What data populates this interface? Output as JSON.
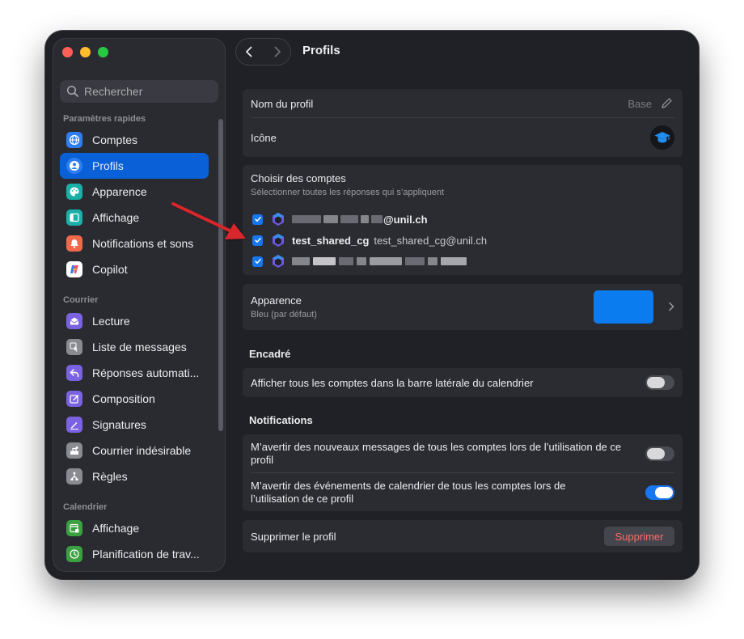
{
  "window": {
    "title": "Profils",
    "accent": "#0a60d6"
  },
  "search": {
    "placeholder": "Rechercher"
  },
  "sidebar": {
    "sections": [
      {
        "label": "Paramètres rapides",
        "items": [
          {
            "label": "Comptes",
            "icon": "globe-icon",
            "color": "#2f7ef0"
          },
          {
            "label": "Profils",
            "icon": "profile-icon",
            "color": "#2f7ef0",
            "active": true
          },
          {
            "label": "Apparence",
            "icon": "palette-icon",
            "color": "#1ab0a8"
          },
          {
            "label": "Affichage",
            "icon": "layout-icon",
            "color": "#1ab0a8"
          },
          {
            "label": "Notifications et sons",
            "icon": "bell-icon",
            "color": "#f06a4a"
          },
          {
            "label": "Copilot",
            "icon": "copilot-icon",
            "color": "#ffffff"
          }
        ]
      },
      {
        "label": "Courrier",
        "items": [
          {
            "label": "Lecture",
            "icon": "envelope-open-icon",
            "color": "#7b62e0"
          },
          {
            "label": "Liste de messages",
            "icon": "list-touch-icon",
            "color": "#8a8b92"
          },
          {
            "label": "Réponses automati...",
            "icon": "reply-icon",
            "color": "#7b62e0"
          },
          {
            "label": "Composition",
            "icon": "compose-icon",
            "color": "#7b62e0"
          },
          {
            "label": "Signatures",
            "icon": "signature-icon",
            "color": "#7b62e0"
          },
          {
            "label": "Courrier indésirable",
            "icon": "junk-icon",
            "color": "#8a8b92"
          },
          {
            "label": "Règles",
            "icon": "rules-icon",
            "color": "#8a8b92"
          }
        ]
      },
      {
        "label": "Calendrier",
        "items": [
          {
            "label": "Affichage",
            "icon": "calendar-icon",
            "color": "#3aa040"
          },
          {
            "label": "Planification de trav...",
            "icon": "clock-icon",
            "color": "#3aa040"
          }
        ]
      }
    ]
  },
  "profile": {
    "name_label": "Nom du profil",
    "name_value": "Base",
    "icon_label": "Icône",
    "icon": "graduation-cap-icon"
  },
  "accounts": {
    "title": "Choisir des comptes",
    "subtitle": "Sélectionner toutes les réponses qui s’appliquent",
    "items": [
      {
        "checked": true,
        "name": "",
        "email_suffix": "@unil.ch",
        "redacted": true
      },
      {
        "checked": true,
        "name": "test_shared_cg",
        "email": "test_shared_cg@unil.ch",
        "redacted": false
      },
      {
        "checked": true,
        "name": "",
        "email_suffix": "",
        "redacted": true
      }
    ]
  },
  "appearance": {
    "title": "Apparence",
    "subtitle": "Bleu (par défaut)",
    "swatch_color": "#0a7cf0"
  },
  "encadre": {
    "heading": "Encadré",
    "show_all_label": "Afficher tous les comptes dans la barre latérale du calendrier",
    "show_all_on": false
  },
  "notifications": {
    "heading": "Notifications",
    "new_messages_label": "M’avertir des nouveaux messages de tous les comptes lors de l’utilisation de ce profil",
    "new_messages_on": false,
    "calendar_events_label": "M’avertir des événements de calendrier de tous les comptes lors de l’utilisation de ce profil",
    "calendar_events_on": true
  },
  "delete": {
    "label": "Supprimer le profil",
    "button": "Supprimer",
    "button_color": "#ff6b64"
  }
}
